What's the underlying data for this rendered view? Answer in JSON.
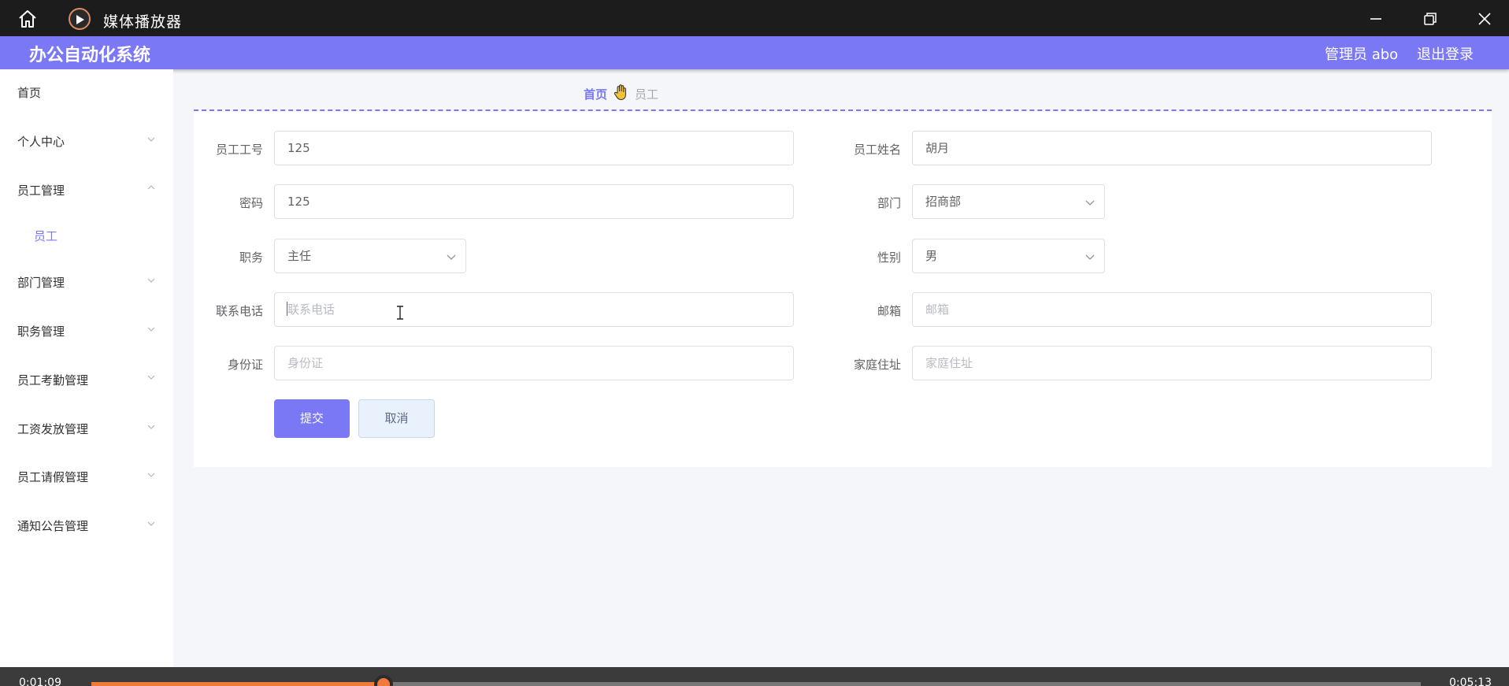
{
  "titlebar": {
    "app_title": "媒体播放器",
    "controls": [
      "minimize-icon",
      "restore-icon",
      "close-icon"
    ]
  },
  "header": {
    "system_title": "办公自动化系统",
    "user": "管理员 abo",
    "logout": "退出登录"
  },
  "sidebar": {
    "items": [
      {
        "label": "首页",
        "has_arrow": false
      },
      {
        "label": "个人中心",
        "has_arrow": true,
        "expanded": false
      },
      {
        "label": "员工管理",
        "has_arrow": true,
        "expanded": true
      },
      {
        "label": "部门管理",
        "has_arrow": true,
        "expanded": false
      },
      {
        "label": "职务管理",
        "has_arrow": true,
        "expanded": false
      },
      {
        "label": "员工考勤管理",
        "has_arrow": true,
        "expanded": false
      },
      {
        "label": "工资发放管理",
        "has_arrow": true,
        "expanded": false
      },
      {
        "label": "员工请假管理",
        "has_arrow": true,
        "expanded": false
      },
      {
        "label": "通知公告管理",
        "has_arrow": true,
        "expanded": false
      }
    ],
    "subitem": "员工"
  },
  "breadcrumb": {
    "home": "首页",
    "current": "员工"
  },
  "form": {
    "emp_no": {
      "label": "员工工号",
      "value": "125"
    },
    "emp_name": {
      "label": "员工姓名",
      "value": "胡月"
    },
    "password": {
      "label": "密码",
      "value": "125"
    },
    "department": {
      "label": "部门",
      "value": "招商部"
    },
    "position": {
      "label": "职务",
      "value": "主任"
    },
    "gender": {
      "label": "性别",
      "value": "男"
    },
    "phone": {
      "label": "联系电话",
      "placeholder": "联系电话"
    },
    "email": {
      "label": "邮箱",
      "placeholder": "邮箱"
    },
    "id_card": {
      "label": "身份证",
      "placeholder": "身份证"
    },
    "address": {
      "label": "家庭住址",
      "placeholder": "家庭住址"
    },
    "submit": "提交",
    "cancel": "取消"
  },
  "player": {
    "current_time": "0:01:09",
    "total_time": "0:05:13",
    "progress": 0.22,
    "accent": "#f07a3a"
  },
  "colors": {
    "accent": "#7b78f5",
    "titlebar": "#1c1c1c"
  }
}
